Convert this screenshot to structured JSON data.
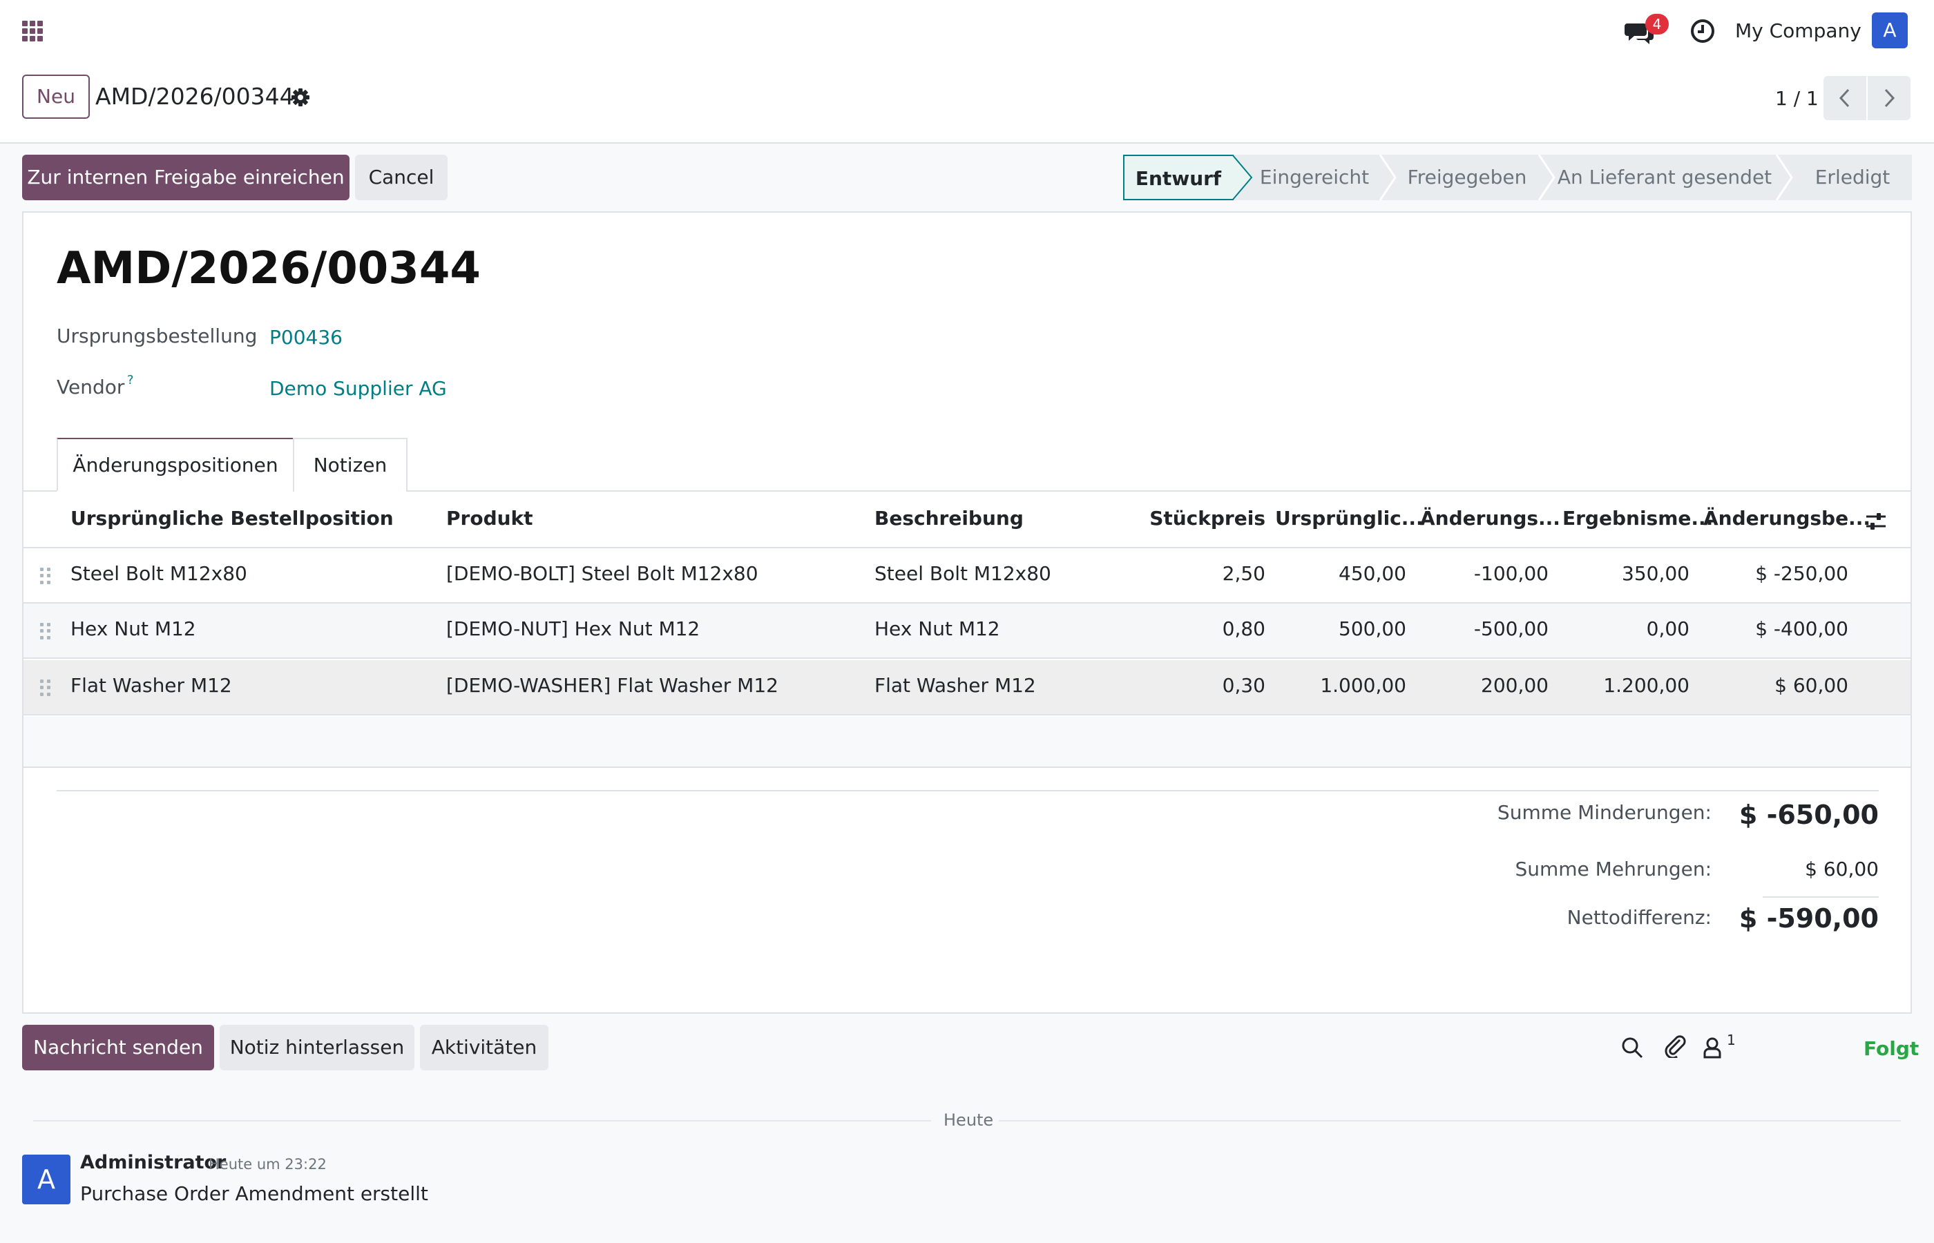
{
  "navbar": {
    "messages_badge": "4",
    "company": "My Company",
    "user_initial": "A"
  },
  "breadcrumb": {
    "new_label": "Neu",
    "title": "AMD/2026/00344"
  },
  "pager": {
    "value": "1 / 1"
  },
  "actions": {
    "submit_label": "Zur internen Freigabe einreichen",
    "cancel_label": "Cancel"
  },
  "statusbar": {
    "stages": [
      "Entwurf",
      "Eingereicht",
      "Freigegeben",
      "An Lieferant gesendet",
      "Erledigt"
    ],
    "active": "Entwurf"
  },
  "form": {
    "title": "AMD/2026/00344",
    "origin_label": "Ursprungsbestellung",
    "origin_value": "P00436",
    "vendor_label": "Vendor",
    "vendor_help": "?",
    "vendor_value": "Demo Supplier AG"
  },
  "tabs": [
    "Änderungspositionen",
    "Notizen"
  ],
  "table": {
    "columns": [
      "Ursprüngliche Bestellposition",
      "Produkt",
      "Beschreibung",
      "Stückpreis",
      "Ursprünglic...",
      "Änderungs...",
      "Ergebnisme...",
      "Änderungsbe..."
    ],
    "rows": [
      [
        "Steel Bolt M12x80",
        "[DEMO-BOLT] Steel Bolt M12x80",
        "Steel Bolt M12x80",
        "2,50",
        "450,00",
        "-100,00",
        "350,00",
        "$ -250,00"
      ],
      [
        "Hex Nut M12",
        "[DEMO-NUT] Hex Nut M12",
        "Hex Nut M12",
        "0,80",
        "500,00",
        "-500,00",
        "0,00",
        "$ -400,00"
      ],
      [
        "Flat Washer M12",
        "[DEMO-WASHER] Flat Washer M12",
        "Flat Washer M12",
        "0,30",
        "1.000,00",
        "200,00",
        "1.200,00",
        "$ 60,00"
      ]
    ]
  },
  "totals": {
    "decrease_label": "Summe Minderungen:",
    "decrease_value": "$ -650,00",
    "increase_label": "Summe Mehrungen:",
    "increase_value": "$ 60,00",
    "net_label": "Nettodifferenz:",
    "net_value": "$ -590,00"
  },
  "chatter": {
    "send_label": "Nachricht senden",
    "note_label": "Notiz hinterlassen",
    "activities_label": "Aktivitäten",
    "followers_count": "1",
    "follow_label": "Folgt",
    "today_label": "Heute",
    "message": {
      "avatar": "A",
      "author": "Administrator",
      "time": "Heute um 23:22",
      "body": "Purchase Order Amendment erstellt"
    }
  },
  "colors": {
    "brand": "#714b67",
    "link": "#017e84",
    "follow": "#28a745",
    "badge": "#e0303b",
    "avatar": "#2d5bd0"
  }
}
